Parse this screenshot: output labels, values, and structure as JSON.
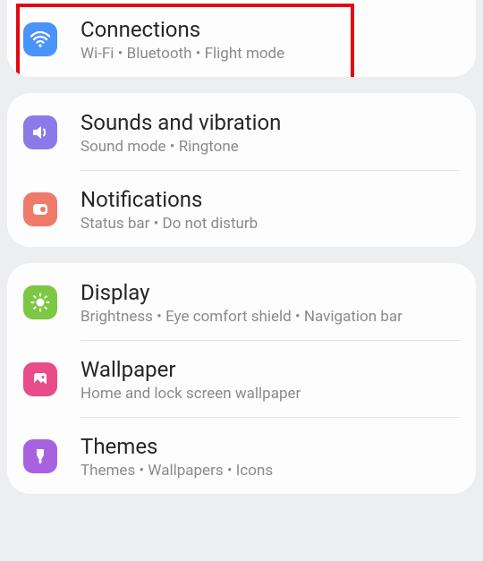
{
  "groups": [
    {
      "items": [
        {
          "key": "connections",
          "icon": "wifi-icon",
          "color": "bg-blue",
          "title": "Connections",
          "subtitle": "Wi-Fi  •  Bluetooth  •  Flight mode",
          "highlighted": true
        }
      ]
    },
    {
      "items": [
        {
          "key": "sounds",
          "icon": "speaker-icon",
          "color": "bg-purple",
          "title": "Sounds and vibration",
          "subtitle": "Sound mode  •  Ringtone"
        },
        {
          "key": "notifications",
          "icon": "notification-icon",
          "color": "bg-coral",
          "title": "Notifications",
          "subtitle": "Status bar  •  Do not disturb"
        }
      ]
    },
    {
      "items": [
        {
          "key": "display",
          "icon": "sun-icon",
          "color": "bg-green",
          "title": "Display",
          "subtitle": "Brightness  •  Eye comfort shield  •  Navigation bar"
        },
        {
          "key": "wallpaper",
          "icon": "image-icon",
          "color": "bg-pink",
          "title": "Wallpaper",
          "subtitle": "Home and lock screen wallpaper"
        },
        {
          "key": "themes",
          "icon": "brush-icon",
          "color": "bg-violet",
          "title": "Themes",
          "subtitle": "Themes  •  Wallpapers  •  Icons"
        }
      ]
    }
  ]
}
